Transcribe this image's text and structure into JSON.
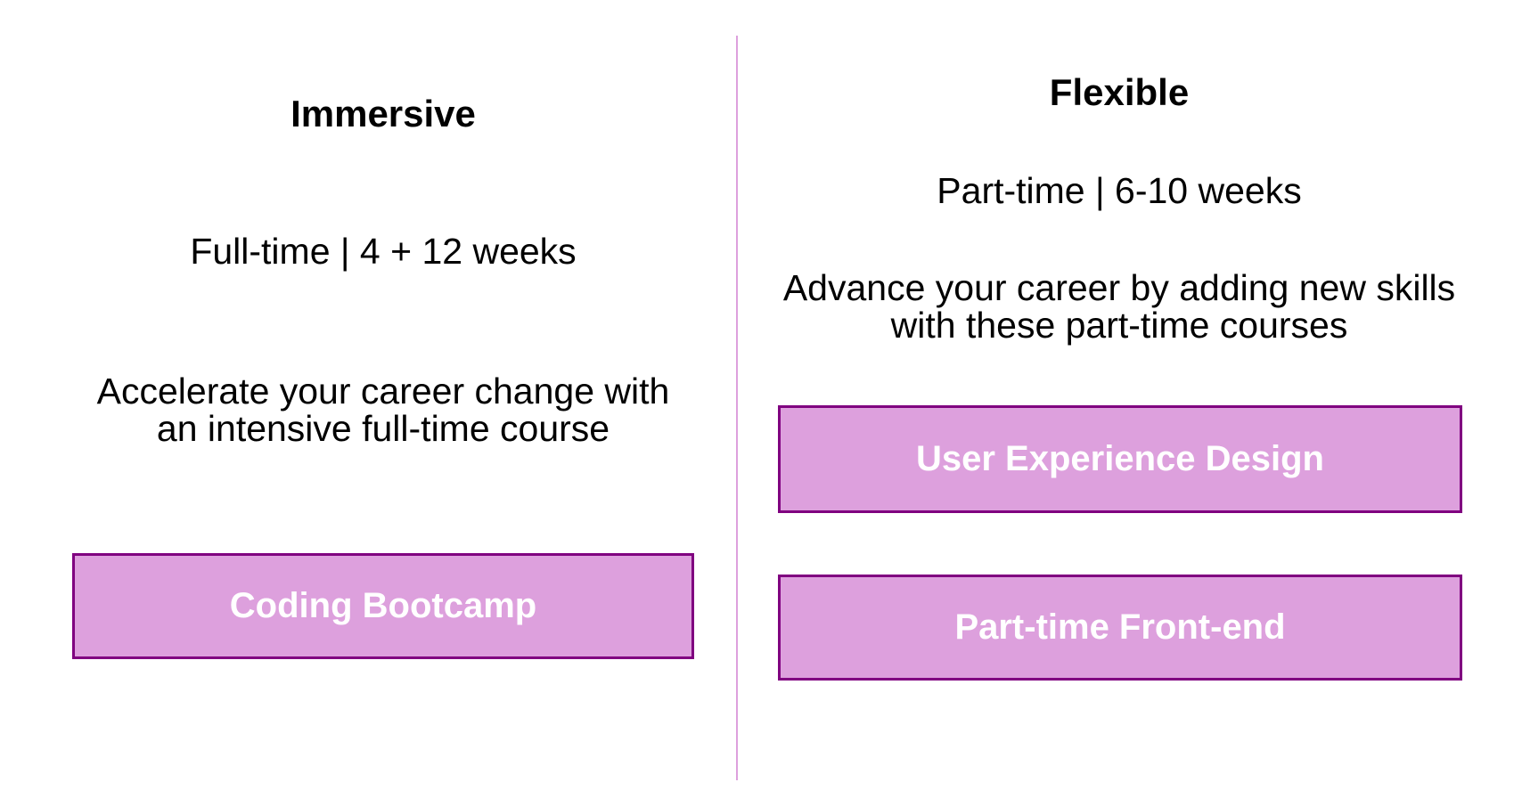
{
  "immersive": {
    "title": "Immersive",
    "schedule": "Full-time | 4 + 12 weeks",
    "description_line1": "Accelerate your career change with",
    "description_line2": "an intensive full-time course",
    "courses": [
      {
        "label": "Coding Bootcamp"
      }
    ]
  },
  "flexible": {
    "title": "Flexible",
    "schedule": "Part-time | 6-10 weeks",
    "description_line1": "Advance your career by adding new skills",
    "description_line2": "with these part-time courses",
    "courses": [
      {
        "label": "User Experience Design"
      },
      {
        "label": "Part-time Front-end"
      }
    ]
  },
  "colors": {
    "button_fill": "#dda0dd",
    "button_border": "#800080",
    "button_text": "#ffffff",
    "divider": "#dda0dd"
  }
}
